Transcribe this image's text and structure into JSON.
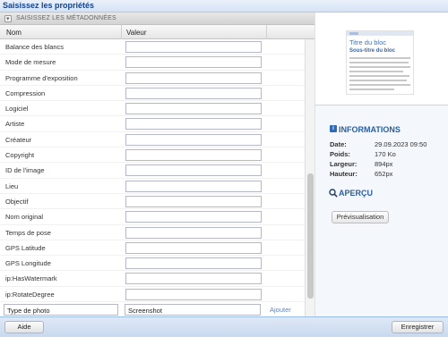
{
  "window": {
    "title": "Saisissez les propriétés"
  },
  "section": {
    "label": "SAISISSEZ LES MÉTADONNÉES"
  },
  "columns": {
    "name": "Nom",
    "value": "Valeur"
  },
  "rows": [
    {
      "name": "Balance des blancs",
      "value": ""
    },
    {
      "name": "Mode de mesure",
      "value": ""
    },
    {
      "name": "Programme d'exposition",
      "value": ""
    },
    {
      "name": "Compression",
      "value": ""
    },
    {
      "name": "Logiciel",
      "value": ""
    },
    {
      "name": "Artiste",
      "value": ""
    },
    {
      "name": "Créateur",
      "value": ""
    },
    {
      "name": "Copyright",
      "value": ""
    },
    {
      "name": "ID de l'image",
      "value": ""
    },
    {
      "name": "Lieu",
      "value": ""
    },
    {
      "name": "Objectif",
      "value": ""
    },
    {
      "name": "Nom original",
      "value": ""
    },
    {
      "name": "Temps de pose",
      "value": ""
    },
    {
      "name": "GPS Latitude",
      "value": ""
    },
    {
      "name": "GPS Longitude",
      "value": ""
    },
    {
      "name": "ip:HasWatermark",
      "value": ""
    },
    {
      "name": "ip:RotateDegree",
      "value": ""
    }
  ],
  "new_entry": {
    "name": "Type de photo",
    "value": "Screenshot",
    "add_label": "Ajouter"
  },
  "preview_thumbnail": {
    "title": "Titre du bloc",
    "subtitle": "Sous-titre du bloc"
  },
  "info": {
    "heading": "INFORMATIONS",
    "items": [
      {
        "key": "Date:",
        "value": "29.09.2023 09:50"
      },
      {
        "key": "Poids:",
        "value": "170 Ko"
      },
      {
        "key": "Largeur:",
        "value": "894px"
      },
      {
        "key": "Hauteur:",
        "value": "652px"
      }
    ]
  },
  "apercu": {
    "heading": "APERÇU",
    "button": "Prévisualisation"
  },
  "footer": {
    "help": "Aide",
    "save": "Enregistrer"
  },
  "colors": {
    "accent": "#2a5ea3",
    "title": "#15428b",
    "link": "#5a86c2"
  }
}
